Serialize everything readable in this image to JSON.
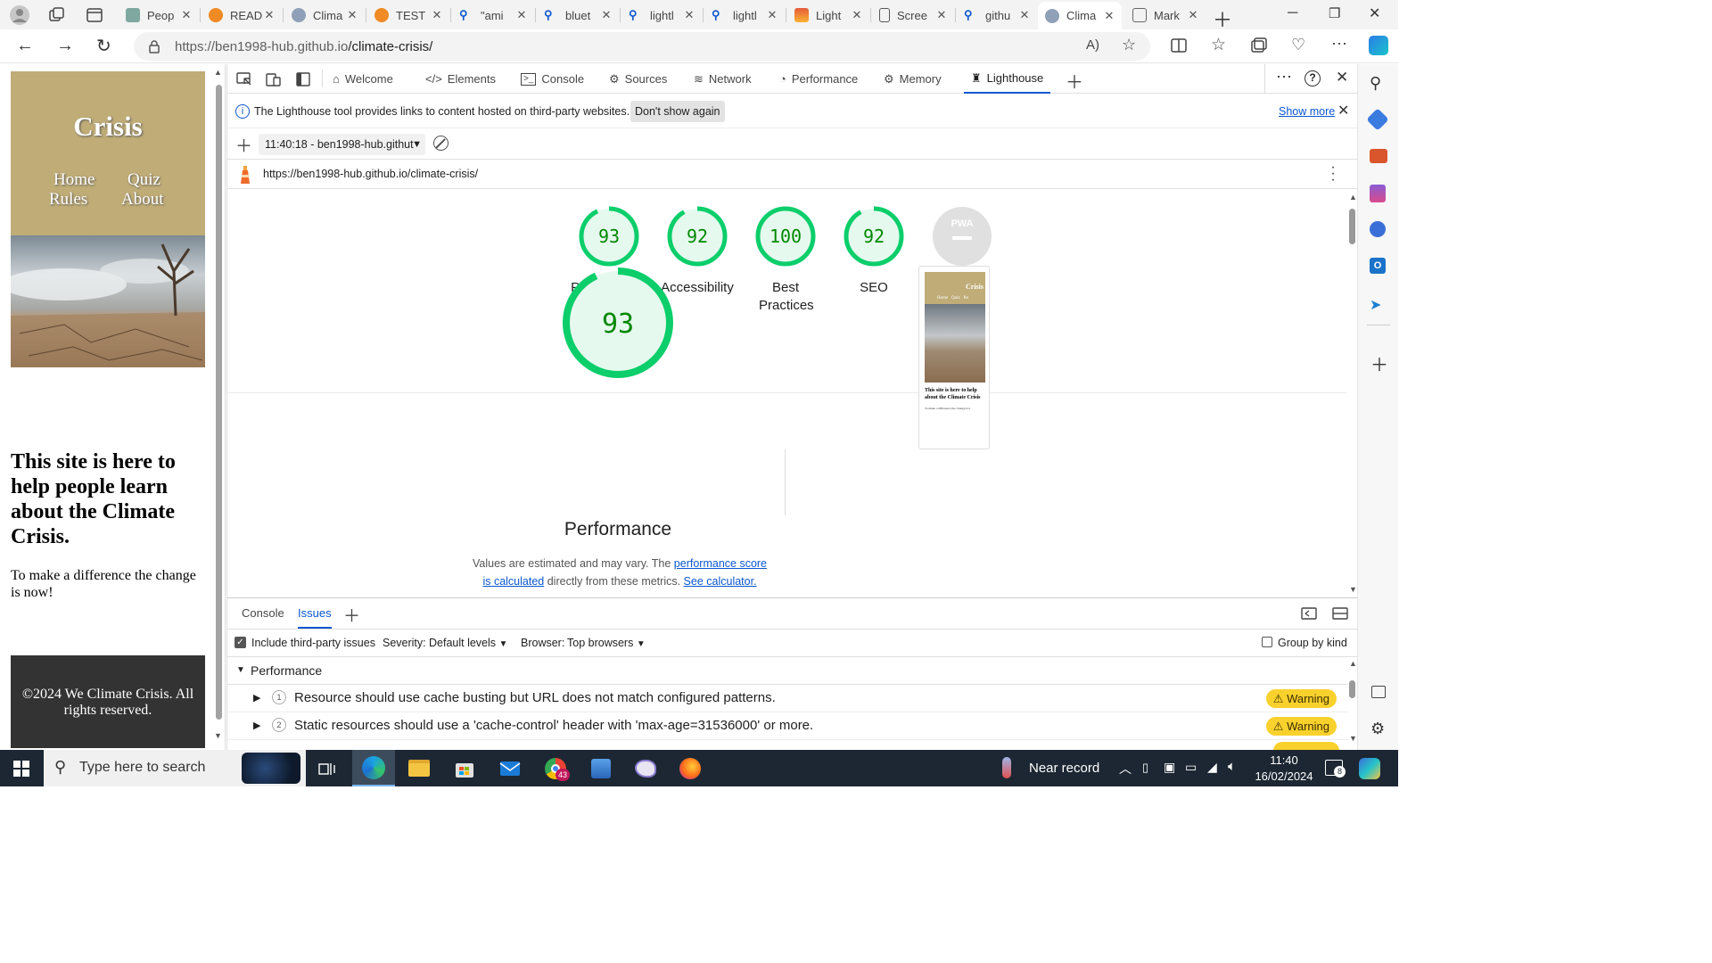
{
  "browser": {
    "tabs": [
      {
        "label": "Peop",
        "color": "#7fa8a0"
      },
      {
        "label": "READ",
        "color": "#f08a24"
      },
      {
        "label": "Clima",
        "color": "#8fa0b8"
      },
      {
        "label": "TEST",
        "color": "#f08a24"
      },
      {
        "label": "\"ami",
        "color": "#0b57d0"
      },
      {
        "label": "bluet",
        "color": "#0b57d0"
      },
      {
        "label": "lightl",
        "color": "#0b57d0"
      },
      {
        "label": "lightl",
        "color": "#0b57d0"
      },
      {
        "label": "Light",
        "color": "#e45b3a"
      },
      {
        "label": "Scree",
        "color": "#555555"
      },
      {
        "label": "githu",
        "color": "#0b57d0"
      },
      {
        "label": "Clima",
        "color": "#8fa0b8"
      },
      {
        "label": "Mark",
        "color": "#666666"
      }
    ],
    "active_tab_index": 11,
    "url_host": "https://ben1998-hub.github.io",
    "url_path": "/climate-crisis/"
  },
  "site": {
    "title": "Crisis",
    "nav": {
      "home": "Home",
      "quiz": "Quiz",
      "rules": "Rules",
      "about": "About"
    },
    "heading": "This site is here to help people learn about the Climate Crisis.",
    "paragraph": "To make a difference the change is now!",
    "footer": "©2024 We Climate Crisis. All rights reserved."
  },
  "devtools": {
    "tabs": [
      "Welcome",
      "Elements",
      "Console",
      "Sources",
      "Network",
      "Performance",
      "Memory",
      "Lighthouse"
    ],
    "active_tab": "Lighthouse",
    "infobar": {
      "message": "The Lighthouse tool provides links to content hosted on third-party websites.",
      "dont_show": "Don't show again",
      "show_more": "Show more"
    },
    "report_select": "11:40:18 - ben1998-hub.githut",
    "report_url": "https://ben1998-hub.github.io/climate-crisis/",
    "scores": [
      {
        "label": "Performance",
        "value": "93",
        "score": 93
      },
      {
        "label": "Accessibility",
        "value": "92",
        "score": 92
      },
      {
        "label": "Best Practices",
        "value": "100",
        "score": 100
      },
      {
        "label": "SEO",
        "value": "92",
        "score": 92
      },
      {
        "label": "PWA",
        "value": "",
        "score": 0
      }
    ],
    "pwa_badge": "PWA",
    "perf": {
      "value": "93",
      "score": 93,
      "title": "Performance",
      "note_prefix": "Values are estimated and may vary. The ",
      "note_link": "performance score is calculated",
      "note_mid": " directly from these metrics. ",
      "note_calc": "See calculator."
    },
    "thumbnail": {
      "title": "Crisis",
      "nav": "Home   Quiz   Ru",
      "heading": "This site is here to help about the Climate Crisis",
      "text": "To make a difference the change is n"
    },
    "drawer": {
      "tabs": [
        "Console",
        "Issues"
      ],
      "active": "Issues",
      "include_third_party": "Include third-party issues",
      "severity_label": "Severity:",
      "severity_value": "Default levels",
      "browser_label": "Browser:",
      "browser_value": "Top browsers",
      "group_by_kind": "Group by kind",
      "group": "Performance",
      "issues": [
        {
          "count": "1",
          "text": "Resource should use cache busting but URL does not match configured patterns.",
          "badge": "⚠ Warning"
        },
        {
          "count": "2",
          "text": "Static resources should use a 'cache-control' header with 'max-age=31536000' or more.",
          "badge": "⚠ Warning"
        }
      ]
    }
  },
  "taskbar": {
    "search_placeholder": "Type here to search",
    "weather": "Near record",
    "time": "11:40",
    "date": "16/02/2024",
    "mail_badge": "43",
    "notif_count": "8"
  },
  "colors": {
    "score_green": "#0cce6b",
    "score_bg": "#e6f9ee",
    "accent": "#0b57d0",
    "warning": "#f9d12c",
    "site_header": "#bfac77"
  }
}
